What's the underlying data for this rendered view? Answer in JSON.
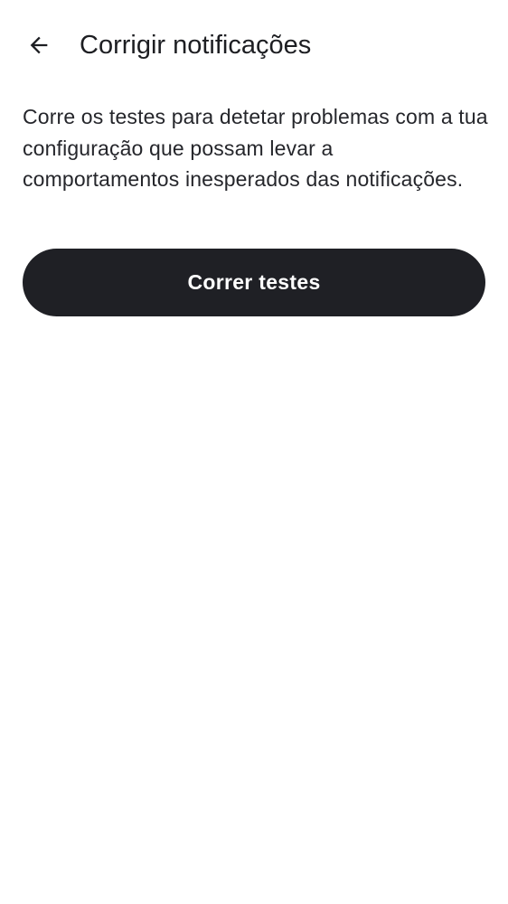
{
  "header": {
    "title": "Corrigir notificações",
    "back_icon": "arrow-left-icon"
  },
  "main": {
    "description": "Corre os testes para detetar problemas com a tua configuração que possam levar a comportamentos inesperados das notificações.",
    "run_tests_label": "Correr testes"
  },
  "colors": {
    "background": "#ffffff",
    "text": "#1d1e22",
    "button_background": "#1f2025",
    "button_text": "#ffffff"
  }
}
